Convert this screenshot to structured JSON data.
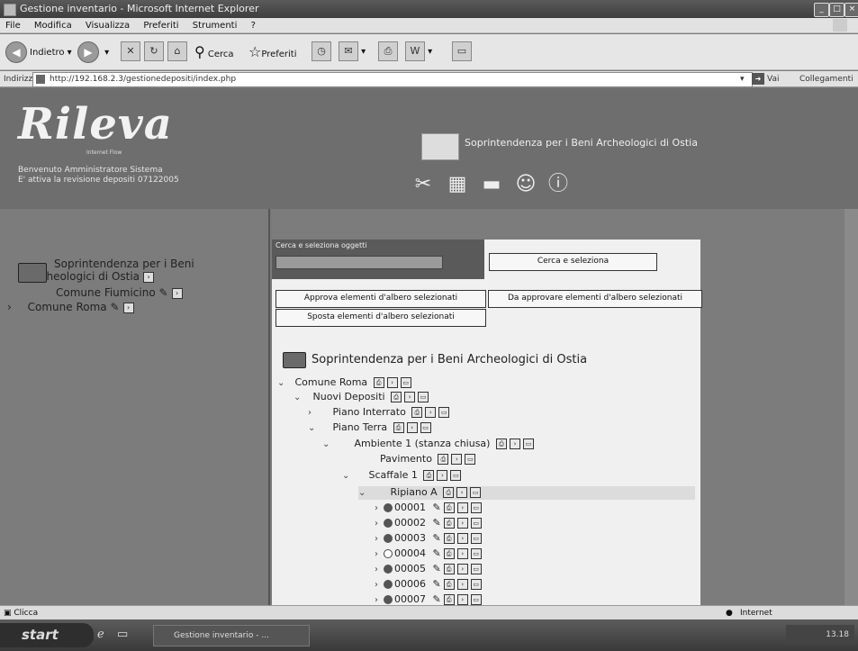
{
  "window": {
    "title": "Gestione inventario - Microsoft Internet Explorer"
  },
  "menu": [
    "File",
    "Modifica",
    "Visualizza",
    "Preferiti",
    "Strumenti",
    "?"
  ],
  "toolbar": {
    "back": "Indietro",
    "search": "Cerca",
    "favorites": "Preferiti"
  },
  "address": {
    "label": "Indirizzo",
    "url": "http://192.168.2.3/gestionedepositi/index.php",
    "go": "Vai",
    "links": "Collegamenti"
  },
  "header": {
    "logo": "Rileva",
    "logo_sub": "Internet Flow",
    "welcome_line1": "Benvenuto Amministratore Sistema",
    "welcome_line2": "E' attiva la revisione depositi 07122005",
    "org_title": "Soprintendenza per i Beni Archeologici di Ostia"
  },
  "left_tree": {
    "root_line1": "Soprintendenza per i Beni",
    "root_line2": "Archeologici di Ostia",
    "items": [
      "Comune Fiumicino",
      "Comune Roma"
    ]
  },
  "search": {
    "label": "Cerca e seleziona oggetti",
    "button": "Cerca e seleziona",
    "approve_button": "Approva elementi d'albero selezionati",
    "to_approve_button": "Da approvare elementi d'albero selezionati",
    "move_button": "Sposta elementi d'albero selezionati"
  },
  "main_tree": {
    "root": "Soprintendenza per i Beni Archeologici di Ostia",
    "comune": "Comune Roma",
    "depositi": "Nuovi Depositi",
    "piano_interrato": "Piano Interrato",
    "piano_terra": "Piano Terra",
    "ambiente": "Ambiente 1 (stanza chiusa)",
    "pavimento": "Pavimento",
    "scaffale": "Scaffale 1",
    "ripiano": "Ripiano A",
    "objects": [
      "00001",
      "00002",
      "00003",
      "00004",
      "00005",
      "00006",
      "00007"
    ]
  },
  "status": {
    "left": "Clicca",
    "zone": "Internet"
  },
  "taskbar": {
    "start": "start",
    "item": "Gestione inventario - ...",
    "clock": "13.18"
  }
}
